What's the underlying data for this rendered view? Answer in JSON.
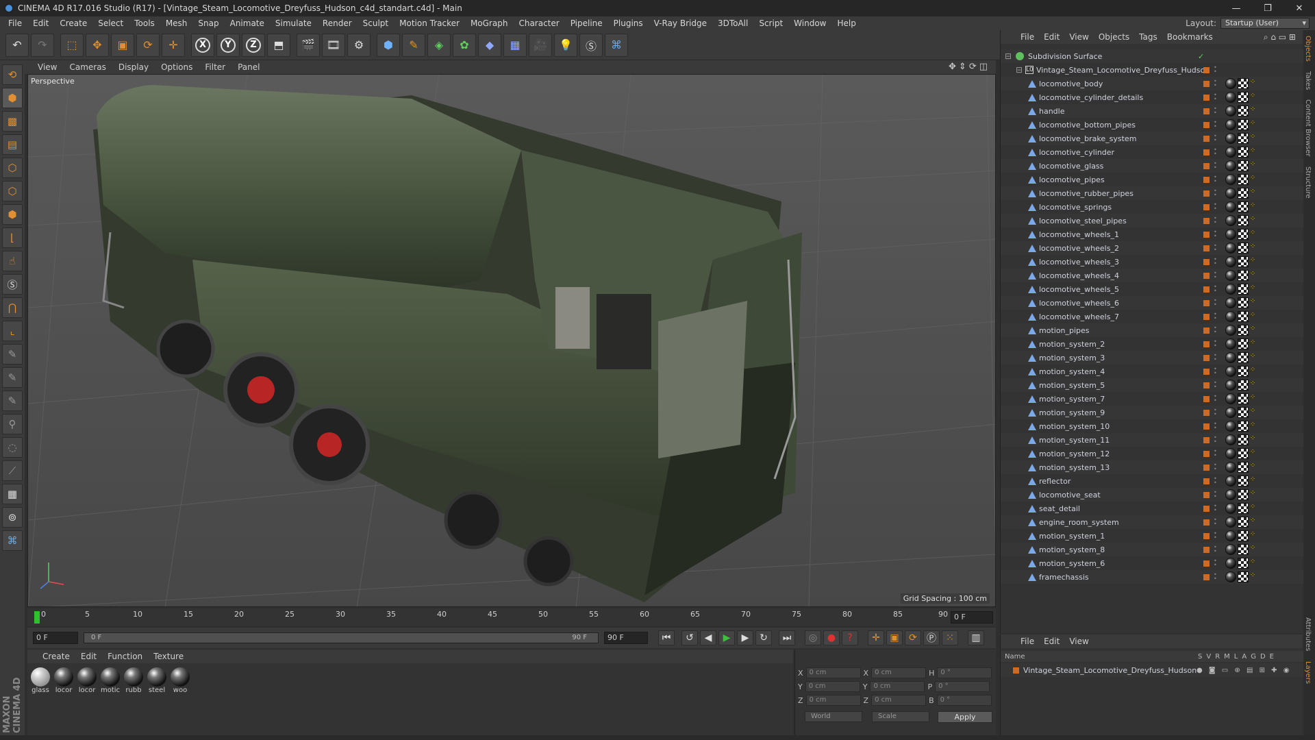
{
  "window": {
    "title": "CINEMA 4D R17.016 Studio (R17) - [Vintage_Steam_Locomotive_Dreyfuss_Hudson_c4d_standart.c4d] - Main",
    "min": "—",
    "max": "❐",
    "close": "✕"
  },
  "menu": [
    "File",
    "Edit",
    "Create",
    "Select",
    "Tools",
    "Mesh",
    "Snap",
    "Animate",
    "Simulate",
    "Render",
    "Sculpt",
    "Motion Tracker",
    "MoGraph",
    "Character",
    "Pipeline",
    "Plugins",
    "V-Ray Bridge",
    "3DToAll",
    "Script",
    "Window",
    "Help"
  ],
  "layout": {
    "label": "Layout:",
    "value": "Startup (User)"
  },
  "toolbar": {
    "x": "X",
    "y": "Y",
    "z": "Z"
  },
  "viewport": {
    "menu": [
      "View",
      "Cameras",
      "Display",
      "Options",
      "Filter",
      "Panel"
    ],
    "label": "Perspective",
    "grid": "Grid Spacing : 100 cm"
  },
  "timeline": {
    "ticks": [
      "0",
      "5",
      "10",
      "15",
      "20",
      "25",
      "30",
      "35",
      "40",
      "45",
      "50",
      "55",
      "60",
      "65",
      "70",
      "75",
      "80",
      "85",
      "90"
    ],
    "frame": "0 F"
  },
  "playback": {
    "start": "0 F",
    "slider_left": "0 F",
    "slider_right": "90 F",
    "end": "90 F"
  },
  "materials": {
    "menu": [
      "Create",
      "Edit",
      "Function",
      "Texture"
    ],
    "items": [
      "glass",
      "locor",
      "locor",
      "motic",
      "rubb",
      "steel",
      "woo"
    ]
  },
  "coords": {
    "x": "X",
    "y": "Y",
    "z": "Z",
    "h": "H",
    "p": "P",
    "b": "B",
    "pos": "0 cm",
    "size": "0 cm",
    "rot": "0 °",
    "world": "World",
    "scale": "Scale",
    "apply": "Apply"
  },
  "objects": {
    "menu": [
      "File",
      "Edit",
      "View",
      "Objects",
      "Tags",
      "Bookmarks"
    ],
    "root": "Subdivision Surface",
    "group": "Vintage_Steam_Locomotive_Dreyfuss_Hudson",
    "group_icon": "L0",
    "items": [
      "locomotive_body",
      "locomotive_cylinder_details",
      "handle",
      "locomotive_bottom_pipes",
      "locomotive_brake_system",
      "locomotive_cylinder",
      "locomotive_glass",
      "locomotive_pipes",
      "locomotive_rubber_pipes",
      "locomotive_springs",
      "locomotive_steel_pipes",
      "locomotive_wheels_1",
      "locomotive_wheels_2",
      "locomotive_wheels_3",
      "locomotive_wheels_4",
      "locomotive_wheels_5",
      "locomotive_wheels_6",
      "locomotive_wheels_7",
      "motion_pipes",
      "motion_system_2",
      "motion_system_3",
      "motion_system_4",
      "motion_system_5",
      "motion_system_7",
      "motion_system_9",
      "motion_system_10",
      "motion_system_11",
      "motion_system_12",
      "motion_system_13",
      "reflector",
      "locomotive_seat",
      "seat_detail",
      "engine_room_system",
      "motion_system_1",
      "motion_system_8",
      "motion_system_6",
      "framechassis"
    ]
  },
  "layers": {
    "menu": [
      "File",
      "Edit",
      "View"
    ],
    "name_header": "Name",
    "cols": [
      "S",
      "V",
      "R",
      "M",
      "L",
      "A",
      "G",
      "D",
      "E"
    ],
    "row": "Vintage_Steam_Locomotive_Dreyfuss_Hudson"
  },
  "sidetabs": [
    "Objects",
    "Takes",
    "Content Browser",
    "Structure",
    "Attributes",
    "Layers"
  ],
  "brand": "MAXON CINEMA 4D",
  "colors": {
    "accent": "#e09030",
    "tag_orange": "#d06a20",
    "poly_blue": "#7aa8e8",
    "loco_green": "#3e4a36"
  }
}
